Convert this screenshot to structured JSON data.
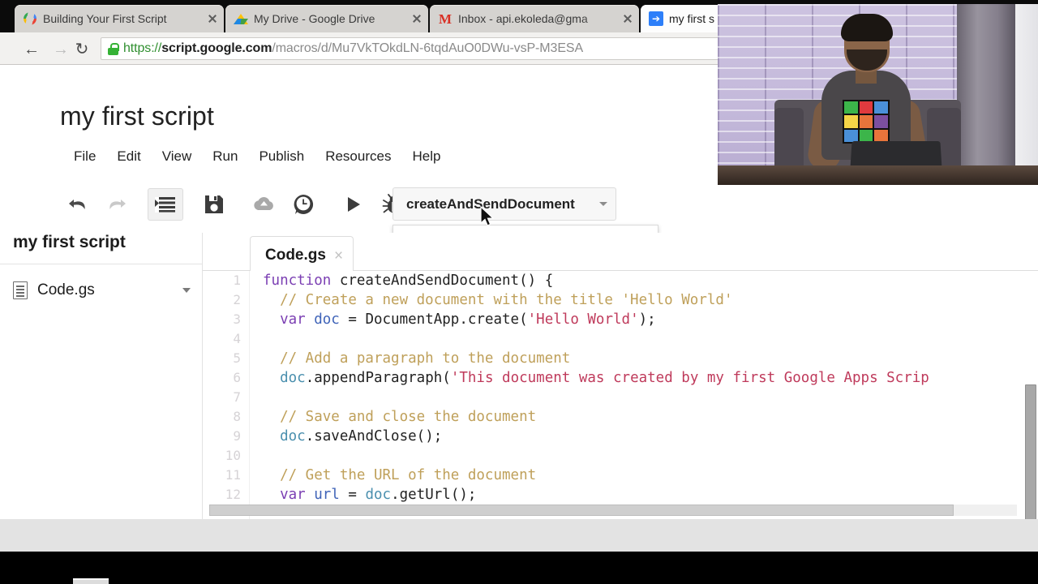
{
  "browser": {
    "tabs": [
      {
        "title": "Building Your First Script",
        "favicon": "apps-script-icon",
        "active": false,
        "close_label": "×"
      },
      {
        "title": "My Drive - Google Drive",
        "favicon": "google-drive-icon",
        "active": false,
        "close_label": "×"
      },
      {
        "title": "Inbox - api.ekoleda@gma",
        "favicon": "gmail-icon",
        "active": false,
        "close_label": "×"
      },
      {
        "title": "my first s",
        "favicon": "apps-script-deploy-icon",
        "active": true,
        "close_label": "×"
      }
    ],
    "nav": {
      "back": "←",
      "forward": "→",
      "reload": "↻"
    },
    "url": {
      "scheme": "https://",
      "host": "script.google.com",
      "path": "/macros/d/Mu7VkTOkdLN-6tqdAuO0DWu-vsP-M3ESA",
      "secure_icon": "lock-icon"
    },
    "menu_icon": "hamburger-menu-icon"
  },
  "app": {
    "title": "my first script",
    "menubar": [
      "File",
      "Edit",
      "View",
      "Run",
      "Publish",
      "Resources",
      "Help"
    ],
    "toolbar": [
      {
        "name": "undo",
        "icon": "undo-arrow-icon",
        "enabled": true
      },
      {
        "name": "redo",
        "icon": "redo-arrow-icon",
        "enabled": false
      },
      {
        "name": "indent",
        "icon": "indent-lines-icon",
        "enabled": true
      },
      {
        "name": "save",
        "icon": "floppy-disk-icon",
        "enabled": true
      },
      {
        "name": "publish",
        "icon": "cloud-upload-icon",
        "enabled": true
      },
      {
        "name": "history",
        "icon": "clock-balloon-icon",
        "enabled": true
      },
      {
        "name": "run",
        "icon": "play-triangle-icon",
        "enabled": true
      },
      {
        "name": "debug",
        "icon": "bug-icon",
        "enabled": true
      }
    ],
    "function_select": {
      "value": "createAndSendDocument",
      "caret_icon": "chevron-down-icon",
      "open": true,
      "options": [
        "createAndSendDocument"
      ]
    },
    "sidebar": {
      "title": "my first script",
      "files": [
        {
          "name": "Code.gs",
          "icon": "file-document-icon",
          "caret_icon": "chevron-down-icon"
        }
      ]
    },
    "editor": {
      "tabs": [
        {
          "name": "Code.gs",
          "close_label": "×",
          "active": true
        }
      ],
      "line_numbers": [
        "1",
        "2",
        "3",
        "4",
        "5",
        "6",
        "7",
        "8",
        "9",
        "10",
        "11",
        "12"
      ],
      "code_lines": [
        [
          {
            "t": "function ",
            "c": "kw"
          },
          {
            "t": "createAndSendDocument",
            "c": "pl"
          },
          {
            "t": "() {",
            "c": "pl"
          }
        ],
        [
          {
            "t": "  // Create a new document with the title 'Hello World'",
            "c": "cm"
          }
        ],
        [
          {
            "t": "  ",
            "c": "pl"
          },
          {
            "t": "var ",
            "c": "kw"
          },
          {
            "t": "doc",
            "c": "ident"
          },
          {
            "t": " = DocumentApp.create(",
            "c": "pl"
          },
          {
            "t": "'Hello World'",
            "c": "str"
          },
          {
            "t": ");",
            "c": "pl"
          }
        ],
        [
          {
            "t": "",
            "c": "pl"
          }
        ],
        [
          {
            "t": "  // Add a paragraph to the document",
            "c": "cm"
          }
        ],
        [
          {
            "t": "  ",
            "c": "pl"
          },
          {
            "t": "doc",
            "c": "obj"
          },
          {
            "t": ".appendParagraph(",
            "c": "pl"
          },
          {
            "t": "'This document was created by my first Google Apps Scrip",
            "c": "str"
          }
        ],
        [
          {
            "t": "",
            "c": "pl"
          }
        ],
        [
          {
            "t": "  // Save and close the document",
            "c": "cm"
          }
        ],
        [
          {
            "t": "  ",
            "c": "pl"
          },
          {
            "t": "doc",
            "c": "obj"
          },
          {
            "t": ".saveAndClose();",
            "c": "pl"
          }
        ],
        [
          {
            "t": "",
            "c": "pl"
          }
        ],
        [
          {
            "t": "  // Get the URL of the document",
            "c": "cm"
          }
        ],
        [
          {
            "t": "  ",
            "c": "pl"
          },
          {
            "t": "var ",
            "c": "kw"
          },
          {
            "t": "url",
            "c": "ident"
          },
          {
            "t": " = ",
            "c": "pl"
          },
          {
            "t": "doc",
            "c": "obj"
          },
          {
            "t": ".getUrl();",
            "c": "pl"
          }
        ]
      ],
      "scrollbars": {
        "vertical": "vertical-scrollbar",
        "horizontal": "horizontal-scrollbar"
      }
    }
  },
  "overlay": {
    "webcam": "presenter-webcam-video"
  },
  "colors": {
    "accent_blue": "#2d7ff9",
    "lock_green": "#35b235",
    "keyword": "#7b3fb3",
    "comment": "#bfa05a",
    "string": "#bf3a5b",
    "identifier": "#3f63b8",
    "gutter_text": "#d6d3d6"
  }
}
